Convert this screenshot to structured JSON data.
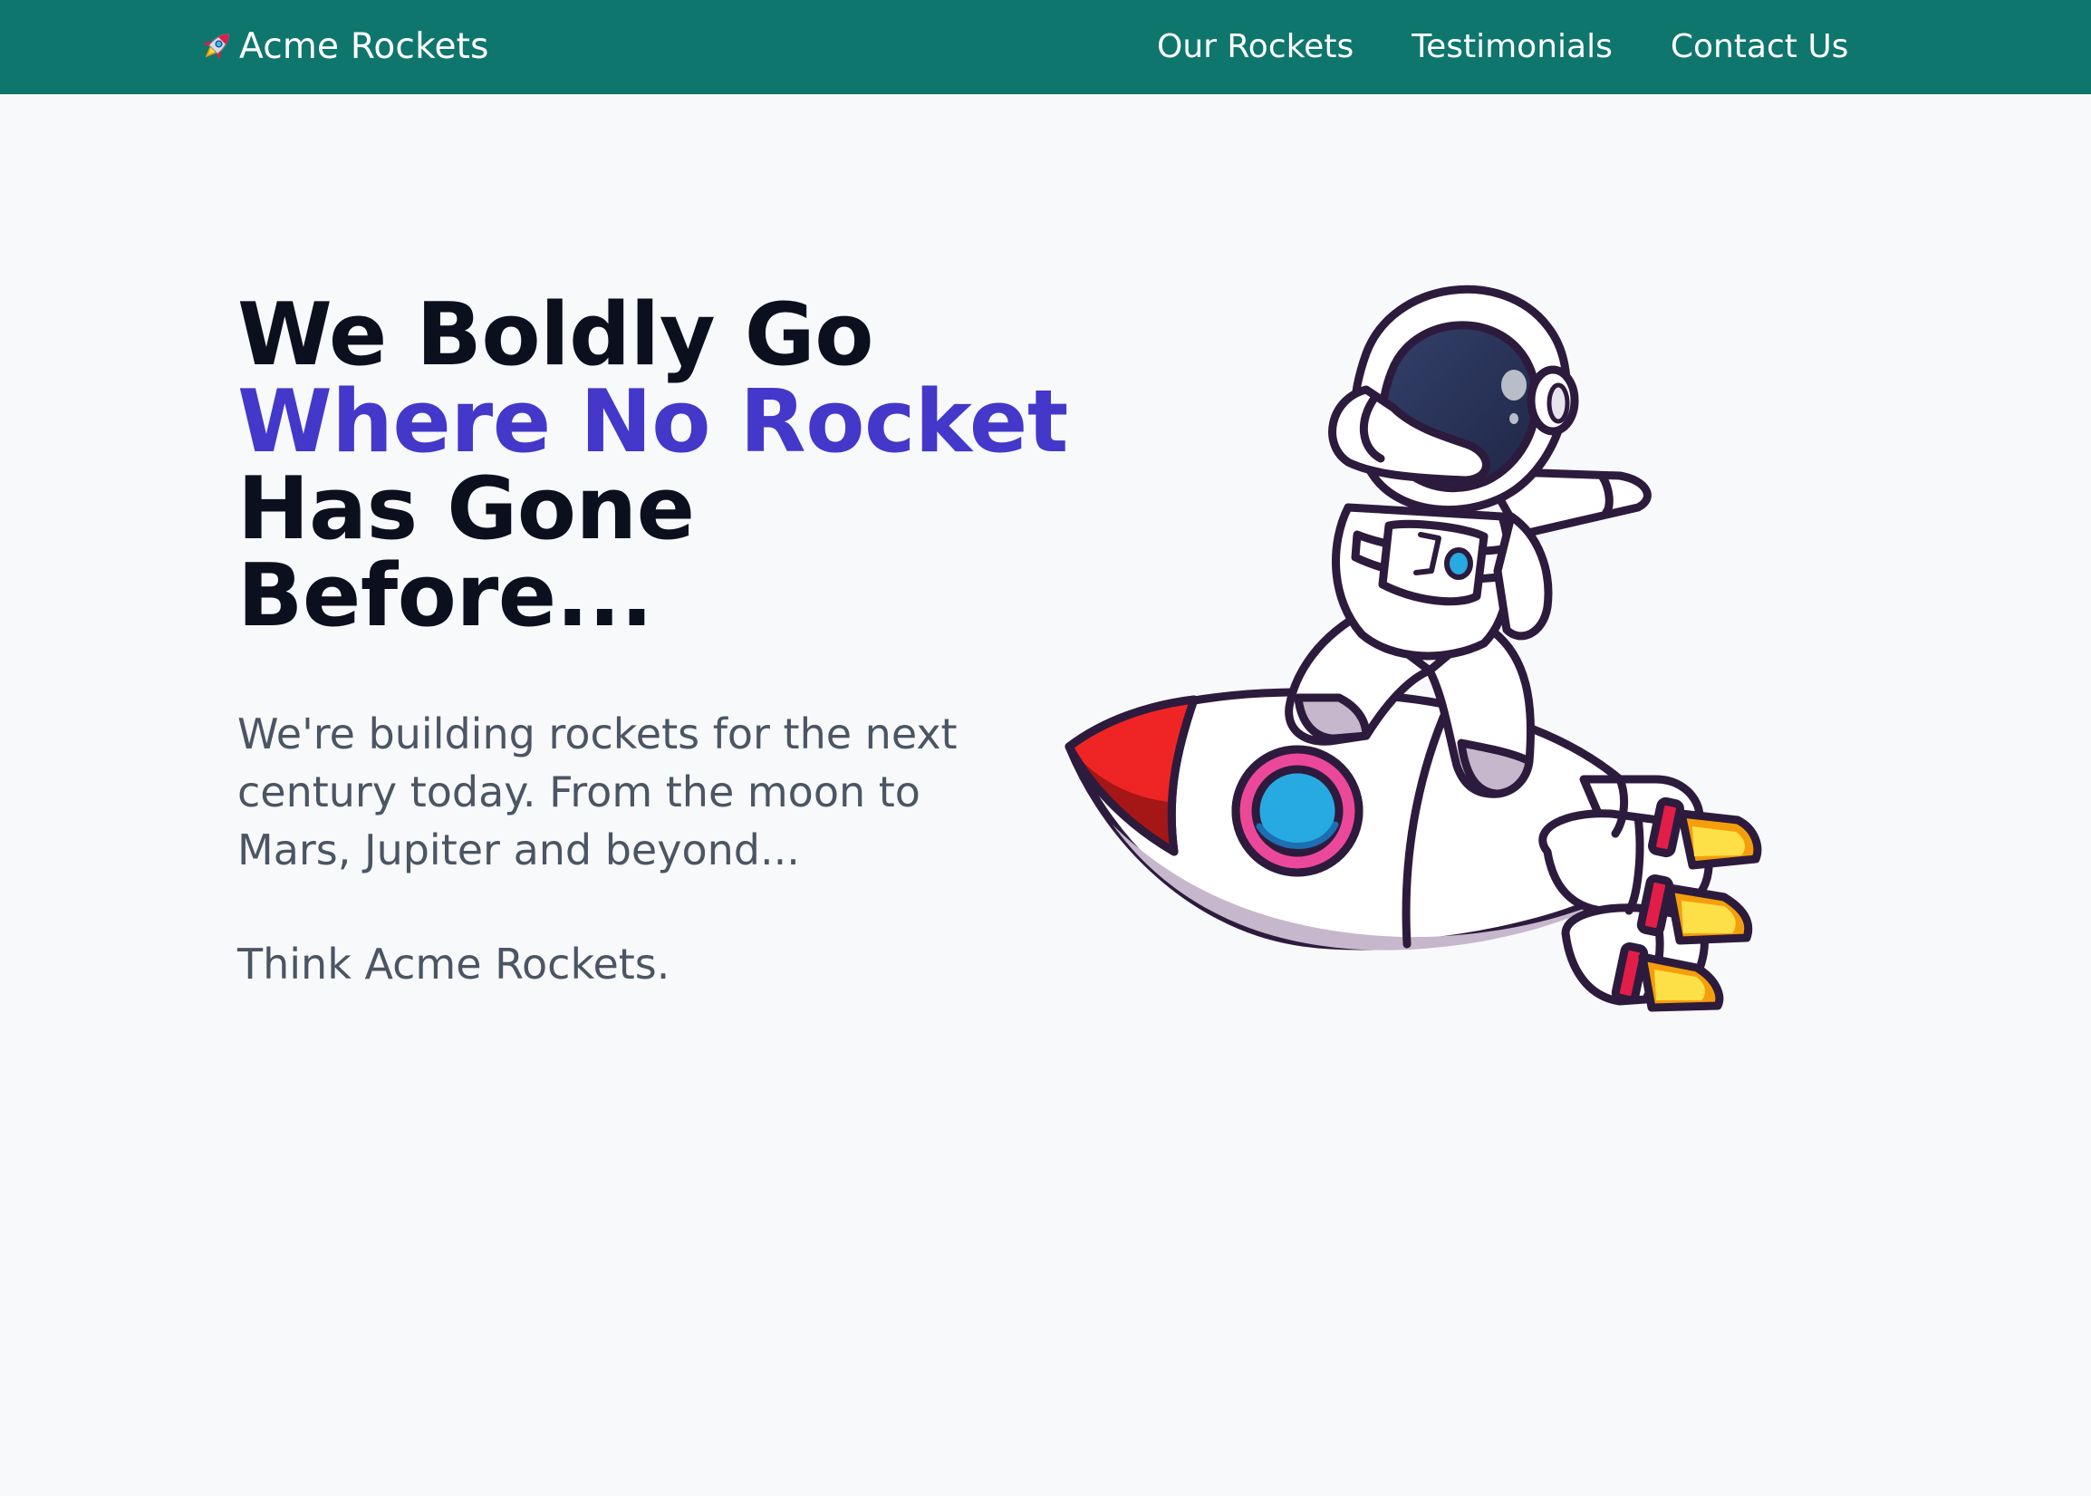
{
  "header": {
    "brand_name": "Acme Rockets",
    "brand_icon": "rocket-icon",
    "nav": [
      {
        "label": "Our Rockets"
      },
      {
        "label": "Testimonials"
      },
      {
        "label": "Contact Us"
      }
    ]
  },
  "hero": {
    "title_line_1": "We Boldly Go",
    "title_line_2": "Where No Rocket",
    "title_line_3": "Has Gone",
    "title_line_4": "Before...",
    "description": "We're building rockets for the next century today. From the moon to Mars, Jupiter and beyond...",
    "tagline": "Think Acme Rockets.",
    "illustration": "astronaut-on-rocket-illustration"
  },
  "colors": {
    "header_bg": "#0f766e",
    "page_bg": "#f8f9fb",
    "title": "#0b0f1e",
    "title_accent": "#4338ca",
    "body_text": "#4b5563"
  }
}
